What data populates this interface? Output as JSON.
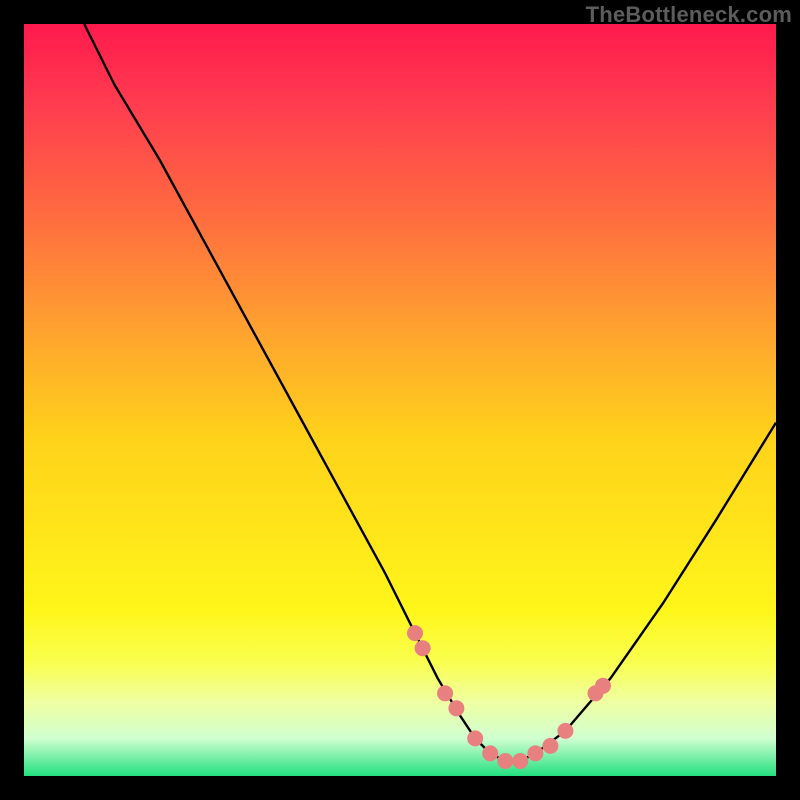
{
  "watermark": "TheBottleneck.com",
  "chart_data": {
    "type": "line",
    "title": "",
    "xlabel": "",
    "ylabel": "",
    "xlim": [
      0,
      100
    ],
    "ylim": [
      0,
      100
    ],
    "series": [
      {
        "name": "bottleneck-curve",
        "x": [
          8,
          12,
          18,
          24,
          30,
          36,
          42,
          48,
          52,
          55,
          58,
          60,
          62,
          64,
          66,
          68,
          72,
          78,
          85,
          92,
          100
        ],
        "values": [
          100,
          92,
          82,
          71,
          60,
          49,
          38,
          27,
          19,
          13,
          8,
          5,
          3,
          2,
          2,
          3,
          6,
          13,
          23,
          34,
          47
        ]
      }
    ],
    "markers": {
      "name": "highlight-points",
      "x": [
        52,
        53,
        56,
        57.5,
        60,
        62,
        64,
        66,
        68,
        70,
        72,
        76,
        77
      ],
      "values": [
        19,
        17,
        11,
        9,
        5,
        3,
        2,
        2,
        3,
        4,
        6,
        11,
        12
      ],
      "color": "#e98080",
      "radius": 8
    }
  }
}
